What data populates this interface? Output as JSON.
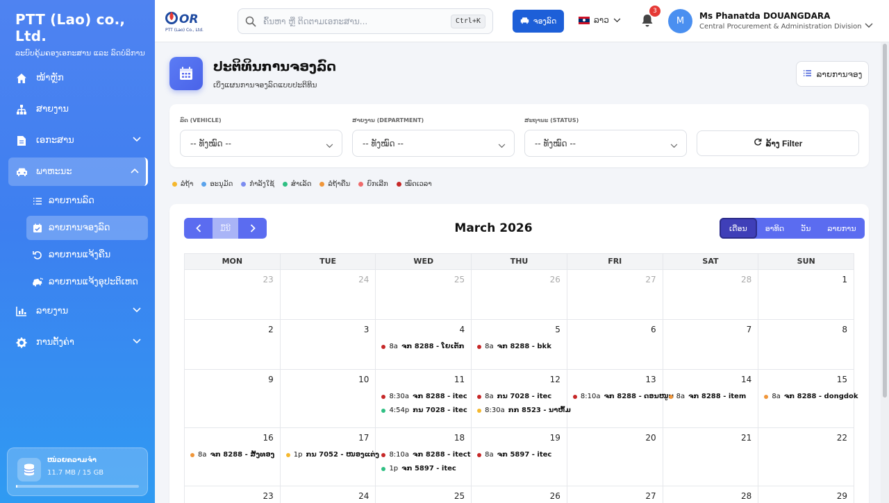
{
  "sidebar": {
    "title": "PTT (Lao) co., Ltd.",
    "subtitle": "ລະບົບຄຸ້ມຄອງເອກະສານ ແລະ ລົດບໍລິການ",
    "items": [
      {
        "label": "ໜ້າຫຼັກ",
        "icon": "home-icon"
      },
      {
        "label": "ສາຍງານ",
        "icon": "org-chart-icon"
      },
      {
        "label": "ເອກະສານ",
        "icon": "document-icon"
      },
      {
        "label": "ພາຫະນະ",
        "icon": "car-icon"
      },
      {
        "label": "ລາຍງານ",
        "icon": "chart-icon"
      },
      {
        "label": "ການຕັ້ງຄ່າ",
        "icon": "gear-icon"
      }
    ],
    "sub_items": [
      {
        "label": "ລາຍການລົດ",
        "icon": "list-icon"
      },
      {
        "label": "ລາຍການຈອງລົດ",
        "icon": "calendar-check-icon"
      },
      {
        "label": "ລາຍການແຈ້ງຄືນ",
        "icon": "undo-icon"
      },
      {
        "label": "ລາຍການແຈ້ງອຸປະຕິເຫດ",
        "icon": "car-crash-icon"
      }
    ],
    "storage": {
      "title": "ໜ່ວຍຄວາມຈຳ",
      "value": "11.7 MB / 15 GB",
      "fraction": 0.0008
    }
  },
  "topbar": {
    "logo_text": "PTT (Lao) Co., Ltd.",
    "search_placeholder": "ຄົ້ນຫາ ຫຼື ຕິດຕາມເອກະສານ...",
    "shortcut": "Ctrl+K",
    "book_button": "ຈອງລົດ",
    "language": "ລາວ",
    "notification_count": "3",
    "avatar_initial": "M",
    "user_name": "Ms Phanatda DOUANGDARA",
    "user_division": "Central Procurement & Administration Division"
  },
  "page": {
    "title": "ປະຕິທິນການຈອງລົດ",
    "subtitle": "ເບິ່ງແຜນການຈອງລົດແບບປະຕິທິນ",
    "list_button": "ລາຍການຈອງ"
  },
  "filters": {
    "vehicle_label": "ລົດ (VEHICLE)",
    "vehicle_value": "-- ທັງໝົດ --",
    "department_label": "ສາຍງານ (DEPARTMENT)",
    "department_value": "-- ທັງໝົດ --",
    "status_label": "ສະຖານະ (STATUS)",
    "status_value": "-- ທັງໝົດ --",
    "reset_label": "ລ້າງ Filter"
  },
  "legend": [
    {
      "label": "ລໍຖ້າ",
      "color": "#f5b82e"
    },
    {
      "label": "ອະນຸມັດ",
      "color": "#5aa3ec"
    },
    {
      "label": "ກຳລັງໃຊ້",
      "color": "#7b8cf0"
    },
    {
      "label": "ສຳເລັດ",
      "color": "#2fbf83"
    },
    {
      "label": "ລໍຖ້າຄືນ",
      "color": "#f0963a"
    },
    {
      "label": "ຍົກເລີກ",
      "color": "#ef6b6b"
    },
    {
      "label": "ໝົດເວລາ",
      "color": "#c62828"
    }
  ],
  "calendar": {
    "title": "March 2026",
    "today_label": "ມື້ນີ້",
    "views": [
      "ເດືອນ",
      "ອາທິດ",
      "ວັນ",
      "ລາຍການ"
    ],
    "weekdays": [
      "MON",
      "TUE",
      "WED",
      "THU",
      "FRI",
      "SAT",
      "SUN"
    ],
    "weeks": [
      {
        "days": [
          {
            "n": "23",
            "other": true,
            "events": []
          },
          {
            "n": "24",
            "other": true,
            "events": []
          },
          {
            "n": "25",
            "other": true,
            "events": []
          },
          {
            "n": "26",
            "other": true,
            "events": []
          },
          {
            "n": "27",
            "other": true,
            "events": []
          },
          {
            "n": "28",
            "other": true,
            "events": []
          },
          {
            "n": "1",
            "other": false,
            "events": []
          }
        ]
      },
      {
        "days": [
          {
            "n": "2",
            "events": []
          },
          {
            "n": "3",
            "events": []
          },
          {
            "n": "4",
            "events": [
              {
                "time": "8a",
                "title": "ຈກ 8288 - ໂຍເຕັກ",
                "color": "#c62828"
              }
            ]
          },
          {
            "n": "5",
            "events": [
              {
                "time": "8a",
                "title": "ຈກ 8288 - bkk",
                "color": "#c62828"
              }
            ]
          },
          {
            "n": "6",
            "events": []
          },
          {
            "n": "7",
            "events": []
          },
          {
            "n": "8",
            "events": []
          }
        ]
      },
      {
        "days": [
          {
            "n": "9",
            "events": []
          },
          {
            "n": "10",
            "events": []
          },
          {
            "n": "11",
            "events": [
              {
                "time": "8:30a",
                "title": "ຈກ 8288 - itec",
                "color": "#c62828"
              },
              {
                "time": "4:54p",
                "title": "ກນ 7028 - itec",
                "color": "#2fbf83"
              }
            ]
          },
          {
            "n": "12",
            "events": [
              {
                "time": "8a",
                "title": "ກນ 7028 - itec",
                "color": "#c62828"
              },
              {
                "time": "8:30a",
                "title": "ກກ 8523 - ນາຫົ້ມ",
                "color": "#f5b82e"
              }
            ]
          },
          {
            "n": "13",
            "events": [
              {
                "time": "8:10a",
                "title": "ຈກ 8288 - ດອນໜູນ",
                "color": "#c62828"
              }
            ]
          },
          {
            "n": "14",
            "events": [
              {
                "time": "8a",
                "title": "ຈກ 8288 - item",
                "color": "#f0963a"
              }
            ]
          },
          {
            "n": "15",
            "events": [
              {
                "time": "8a",
                "title": "ຈກ 8288 - dongdok",
                "color": "#f0963a"
              }
            ]
          }
        ]
      },
      {
        "days": [
          {
            "n": "16",
            "events": [
              {
                "time": "8a",
                "title": "ຈກ 8288 - ສັງທອງ",
                "color": "#f0963a"
              }
            ]
          },
          {
            "n": "17",
            "events": [
              {
                "time": "1p",
                "title": "ກນ 7052 - ໜອງແຕ່ງ",
                "color": "#f5b82e"
              }
            ]
          },
          {
            "n": "18",
            "events": [
              {
                "time": "8:10a",
                "title": "ຈກ 8288 - itect",
                "color": "#c62828"
              },
              {
                "time": "1p",
                "title": "ຈກ 5897 - itec",
                "color": "#2fbf83"
              }
            ]
          },
          {
            "n": "19",
            "events": [
              {
                "time": "8a",
                "title": "ຈກ 5897 - itec",
                "color": "#c62828"
              }
            ]
          },
          {
            "n": "20",
            "events": []
          },
          {
            "n": "21",
            "events": []
          },
          {
            "n": "22",
            "events": []
          }
        ]
      },
      {
        "days": [
          {
            "n": "23",
            "events": []
          },
          {
            "n": "24",
            "events": []
          },
          {
            "n": "25",
            "events": []
          },
          {
            "n": "26",
            "events": []
          },
          {
            "n": "27",
            "events": []
          },
          {
            "n": "28",
            "events": []
          },
          {
            "n": "29",
            "events": []
          }
        ]
      }
    ]
  }
}
